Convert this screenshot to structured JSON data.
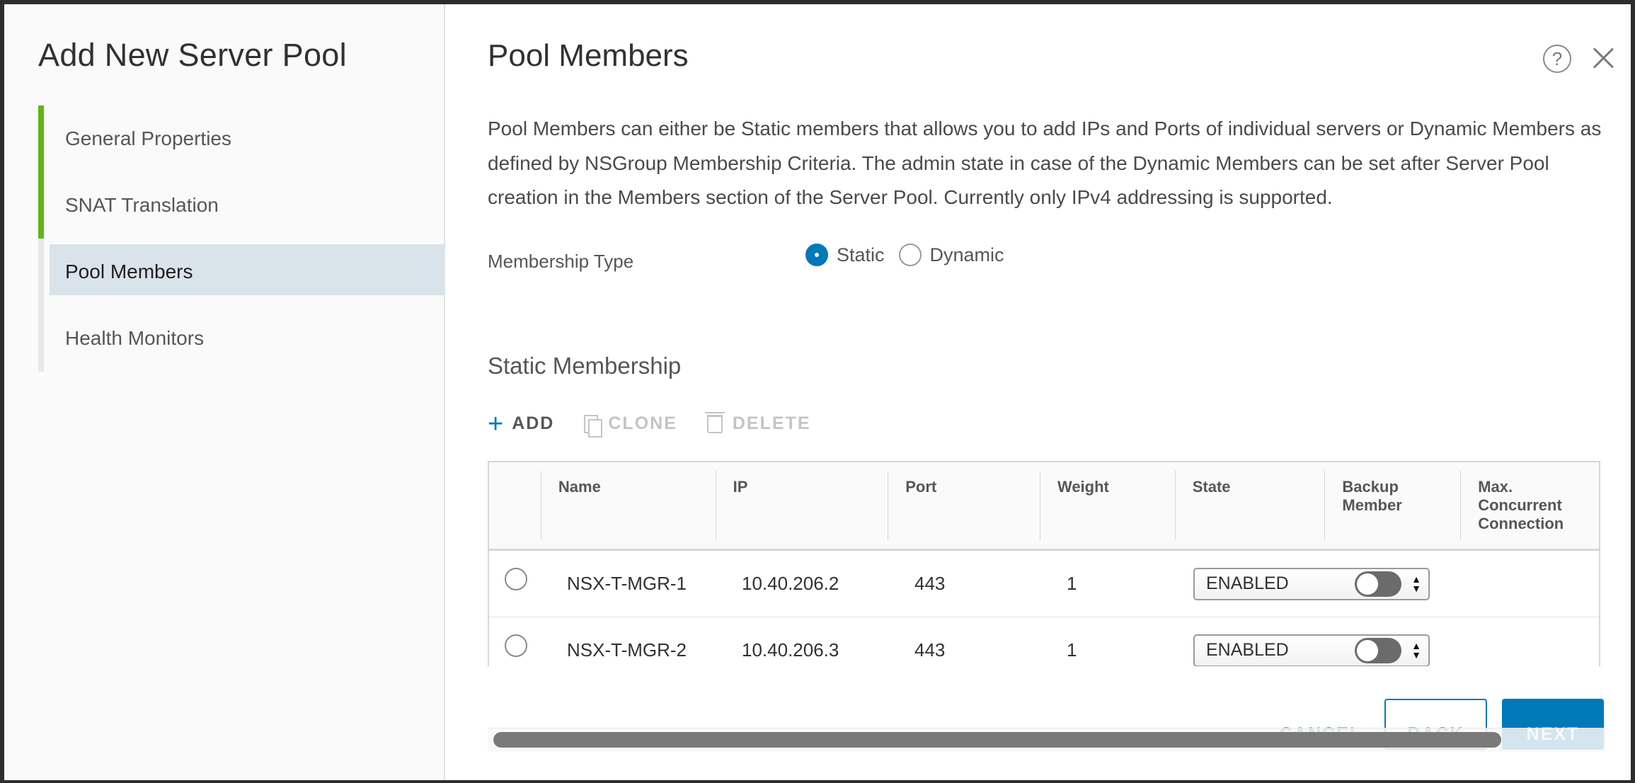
{
  "wizard": {
    "title": "Add New Server Pool",
    "steps": [
      {
        "label": "General Properties",
        "status": "done"
      },
      {
        "label": "SNAT Translation",
        "status": "done"
      },
      {
        "label": "Pool Members",
        "status": "current"
      },
      {
        "label": "Health Monitors",
        "status": "pending"
      }
    ]
  },
  "page": {
    "title": "Pool Members",
    "description": "Pool Members can either be Static members that allows you to add IPs and Ports of individual servers or Dynamic Members as defined by NSGroup Membership Criteria. The admin state in case of the Dynamic Members can be set after Server Pool creation in the Members section of the Server Pool. Currently only IPv4 addressing is supported.",
    "help_icon_glyph": "?",
    "membership_type": {
      "label": "Membership Type",
      "options": [
        "Static",
        "Dynamic"
      ],
      "selected": "Static"
    }
  },
  "static_membership": {
    "title": "Static Membership",
    "toolbar": {
      "add_label": "ADD",
      "clone_label": "CLONE",
      "delete_label": "DELETE"
    },
    "columns": {
      "name": "Name",
      "ip": "IP",
      "port": "Port",
      "weight": "Weight",
      "state": "State",
      "backup": "Backup Member",
      "max_conn": "Max. Concurrent Connection"
    },
    "rows": [
      {
        "name": "NSX-T-MGR-1",
        "ip": "10.40.206.2",
        "port": "443",
        "weight": "1",
        "state": "ENABLED"
      },
      {
        "name": "NSX-T-MGR-2",
        "ip": "10.40.206.3",
        "port": "443",
        "weight": "1",
        "state": "ENABLED"
      }
    ]
  },
  "footer": {
    "cancel_label": "CANCEL",
    "back_label": "BACK",
    "next_label": "NEXT"
  },
  "colors": {
    "accent": "#0079b8",
    "step_done": "#60b515",
    "step_current_bg": "#d9e4ea"
  }
}
